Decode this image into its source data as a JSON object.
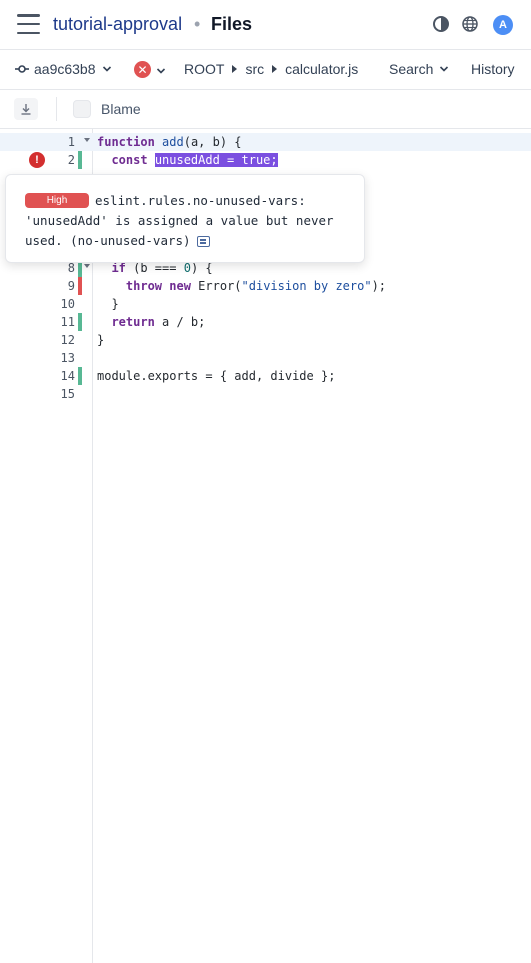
{
  "header": {
    "project": "tutorial-approval",
    "separator": "•",
    "page": "Files",
    "avatar_initial": "A"
  },
  "toolbar": {
    "commit": "aa9c63b8",
    "path": [
      "ROOT",
      "src",
      "calculator.js"
    ],
    "search_label": "Search",
    "history_label": "History"
  },
  "blame": {
    "label": "Blame"
  },
  "code": {
    "lines": [
      {
        "n": "1"
      },
      {
        "n": "2"
      },
      {
        "n": "8"
      },
      {
        "n": "9"
      },
      {
        "n": "10"
      },
      {
        "n": "11"
      },
      {
        "n": "12"
      },
      {
        "n": "13"
      },
      {
        "n": "14"
      },
      {
        "n": "15"
      }
    ]
  },
  "tooltip": {
    "severity": "High",
    "message": "eslint.rules.no-unused-vars: 'unusedAdd' is assigned a value but never used. (no-unused-vars)"
  },
  "colors": {
    "accent": "#4c8ef5",
    "error": "#e05252",
    "added": "#58b894",
    "selection": "#7b4fe0"
  }
}
